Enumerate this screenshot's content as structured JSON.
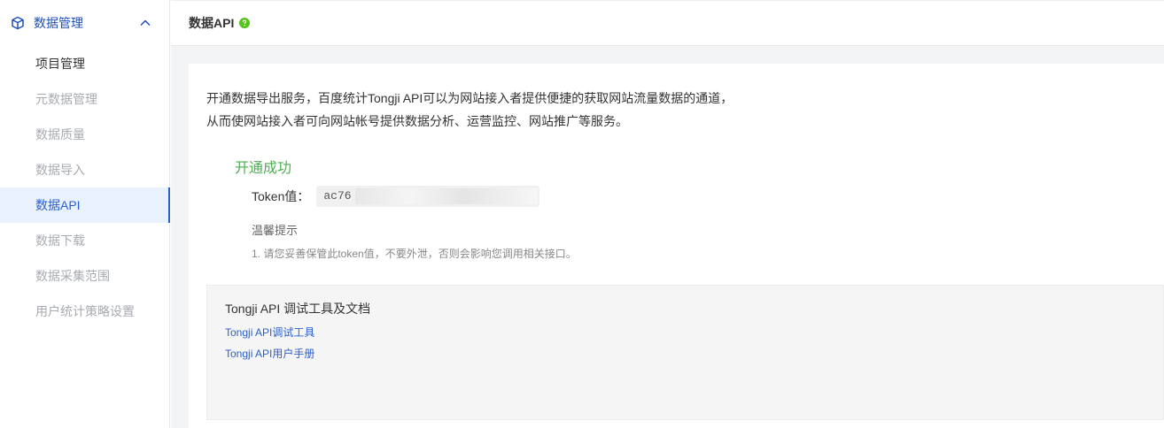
{
  "sidebar": {
    "section_title": "数据管理",
    "items": [
      {
        "label": "项目管理",
        "state": "dark"
      },
      {
        "label": "元数据管理",
        "state": "muted"
      },
      {
        "label": "数据质量",
        "state": "muted"
      },
      {
        "label": "数据导入",
        "state": "muted"
      },
      {
        "label": "数据API",
        "state": "active"
      },
      {
        "label": "数据下载",
        "state": "muted"
      },
      {
        "label": "数据采集范围",
        "state": "muted"
      },
      {
        "label": "用户统计策略设置",
        "state": "muted"
      }
    ]
  },
  "header": {
    "title": "数据API"
  },
  "content": {
    "intro_line1": "开通数据导出服务，百度统计Tongji API可以为网站接入者提供便捷的获取网站流量数据的通道，",
    "intro_line2": "从而使网站接入者可向网站帐号提供数据分析、运营监控、网站推广等服务。",
    "success_title": "开通成功",
    "token_label": "Token值：",
    "token_value": "ac76",
    "tips_title": "温馨提示",
    "tips_item": "1. 请您妥善保管此token值，不要外泄，否则会影响您调用相关接口。"
  },
  "tools": {
    "title": "Tongji API 调试工具及文档",
    "link_debug": "Tongji API调试工具",
    "link_manual": "Tongji API用户手册"
  },
  "colors": {
    "accent": "#2a5fd0",
    "success": "#4caf50",
    "muted_text": "#a7abb2"
  },
  "icons": {
    "section": "cube-icon",
    "collapse": "chevron-up-icon",
    "help": "help-circle-icon"
  }
}
